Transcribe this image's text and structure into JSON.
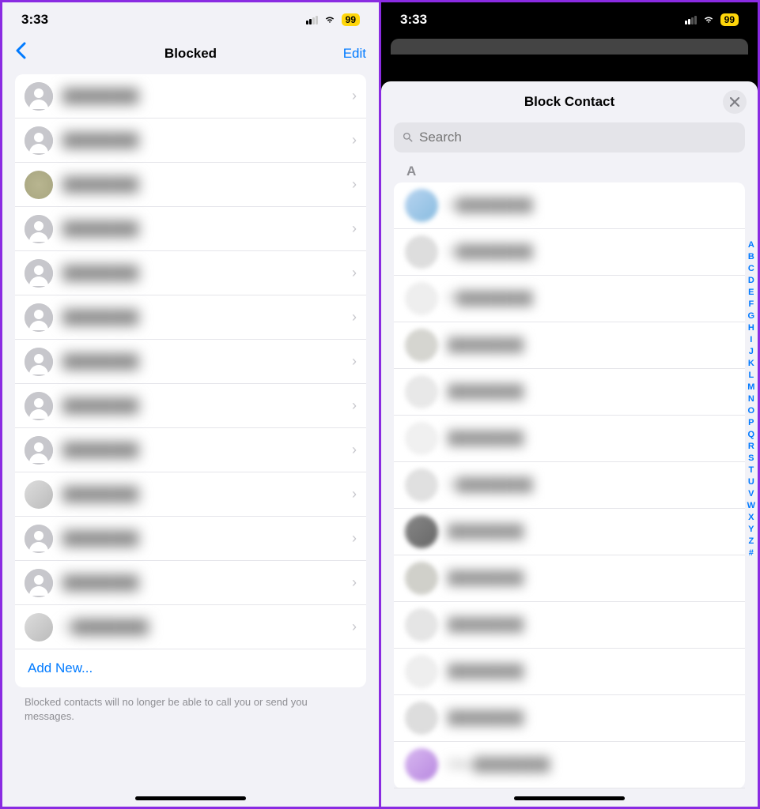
{
  "status": {
    "time": "3:33",
    "battery": "99"
  },
  "left": {
    "title": "Blocked",
    "edit": "Edit",
    "rows": [
      {
        "name": "████████",
        "avatar": "default"
      },
      {
        "name": "████████",
        "avatar": "default"
      },
      {
        "name": "████████",
        "avatar": "photo1"
      },
      {
        "name": "████████",
        "avatar": "default"
      },
      {
        "name": "████████",
        "avatar": "default"
      },
      {
        "name": "████████",
        "avatar": "default"
      },
      {
        "name": "████████",
        "avatar": "default"
      },
      {
        "name": "████████",
        "avatar": "default"
      },
      {
        "name": "████████",
        "avatar": "default"
      },
      {
        "name": "████████",
        "avatar": "photo2"
      },
      {
        "name": "████████",
        "avatar": "default"
      },
      {
        "name": "████████",
        "avatar": "default"
      },
      {
        "name": "U████████",
        "avatar": "photo2"
      }
    ],
    "addNew": "Add New...",
    "footer": "Blocked contacts will no longer be able to call you or send you messages."
  },
  "right": {
    "title": "Block Contact",
    "searchPlaceholder": "Search",
    "section": "A",
    "contacts": [
      {
        "name": "A████████",
        "color": "linear-gradient(135deg,#b8d4f0,#88bce0)"
      },
      {
        "name": "A████████",
        "color": "#ddd"
      },
      {
        "name": "P████████",
        "color": "#eee"
      },
      {
        "name": "████████",
        "color": "#d5d5d0"
      },
      {
        "name": "████████",
        "color": "#e8e8e8"
      },
      {
        "name": "████████",
        "color": "#f0f0f0"
      },
      {
        "name": "S████████",
        "color": "#e0e0e0"
      },
      {
        "name": "████████",
        "color": "linear-gradient(135deg,#888,#666)"
      },
      {
        "name": "████████",
        "color": "#d0d0ca"
      },
      {
        "name": "████████",
        "color": "#e5e5e5"
      },
      {
        "name": "████████",
        "color": "#eee"
      },
      {
        "name": "████████",
        "color": "#ddd"
      },
      {
        "name": "Diks████████",
        "color": "linear-gradient(135deg,#d8b8f0,#b888e0)"
      }
    ],
    "index": [
      "A",
      "B",
      "C",
      "D",
      "E",
      "F",
      "G",
      "H",
      "I",
      "J",
      "K",
      "L",
      "M",
      "N",
      "O",
      "P",
      "Q",
      "R",
      "S",
      "T",
      "U",
      "V",
      "W",
      "X",
      "Y",
      "Z",
      "#"
    ]
  }
}
